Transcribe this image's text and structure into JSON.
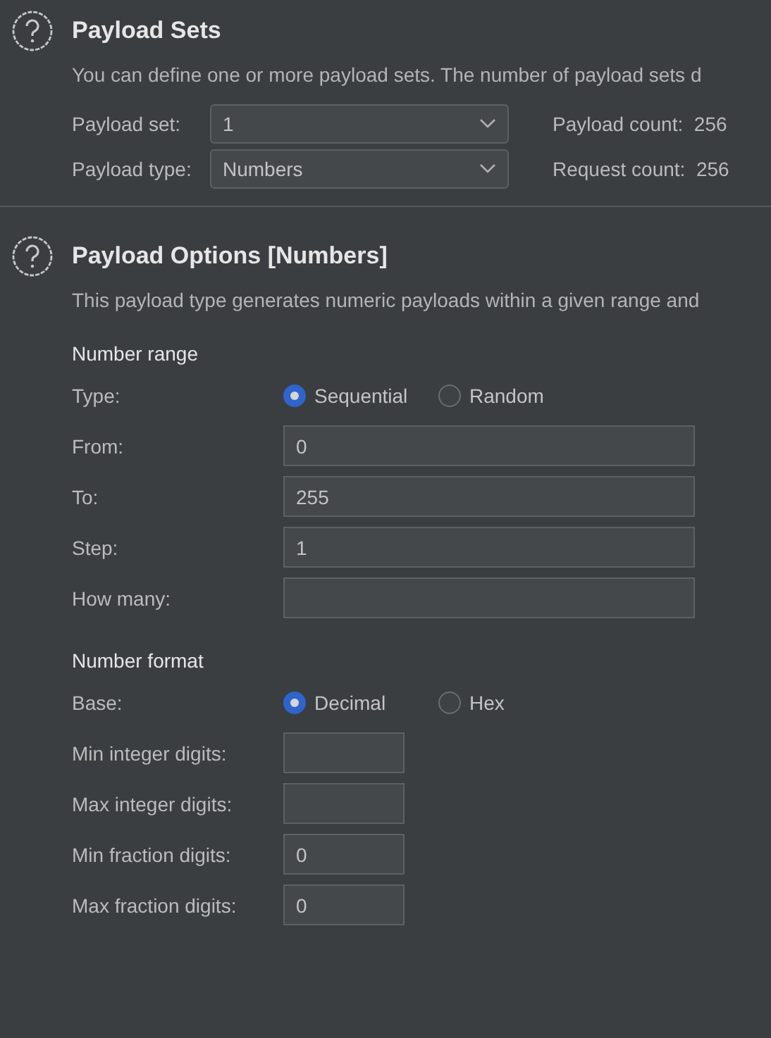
{
  "sections": [
    {
      "title": "Payload Sets",
      "description": "You can define one or more payload sets. The number of payload sets d",
      "selects": [
        {
          "label": "Payload set:",
          "value": "1",
          "info_label": "Payload count:",
          "info_value": "256"
        },
        {
          "label": "Payload type:",
          "value": "Numbers",
          "info_label": "Request count:",
          "info_value": "256"
        }
      ]
    },
    {
      "title": "Payload Options [Numbers]",
      "description": "This payload type generates numeric payloads within a given range and",
      "groups": [
        {
          "heading": "Number range",
          "rows": [
            {
              "kind": "radio",
              "label": "Type:",
              "options": [
                {
                  "label": "Sequential",
                  "selected": true
                },
                {
                  "label": "Random",
                  "selected": false
                }
              ]
            },
            {
              "kind": "wide",
              "label": "From:",
              "value": "0"
            },
            {
              "kind": "wide",
              "label": "To:",
              "value": "255"
            },
            {
              "kind": "wide",
              "label": "Step:",
              "value": "1"
            },
            {
              "kind": "wide",
              "label": "How many:"
            }
          ]
        },
        {
          "heading": "Number format",
          "rows": [
            {
              "kind": "radio",
              "label": "Base:",
              "options": [
                {
                  "label": "Decimal",
                  "selected": true
                },
                {
                  "label": "Hex",
                  "selected": false
                }
              ]
            },
            {
              "kind": "short",
              "label": "Min integer digits:"
            },
            {
              "kind": "short",
              "label": "Max integer digits:"
            },
            {
              "kind": "short",
              "label": "Min fraction digits:",
              "value": "0"
            },
            {
              "kind": "short",
              "label": "Max fraction digits:",
              "value": "0"
            }
          ]
        }
      ]
    }
  ]
}
